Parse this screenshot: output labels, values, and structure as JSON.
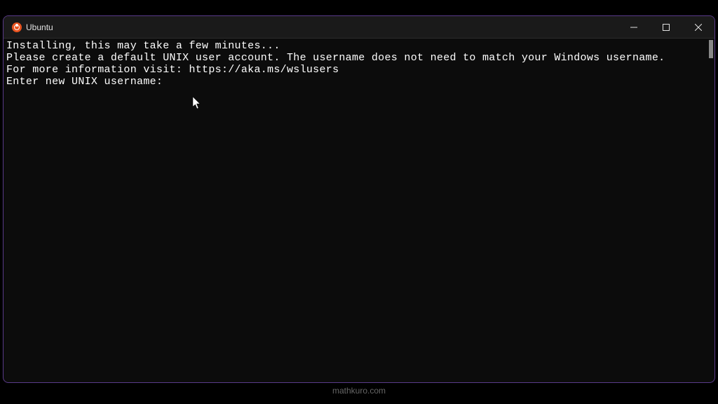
{
  "window": {
    "title": "Ubuntu"
  },
  "terminal": {
    "lines": [
      "Installing, this may take a few minutes...",
      "Please create a default UNIX user account. The username does not need to match your Windows username.",
      "For more information visit: https://aka.ms/wslusers",
      "Enter new UNIX username:"
    ]
  },
  "watermark": "mathkuro.com"
}
